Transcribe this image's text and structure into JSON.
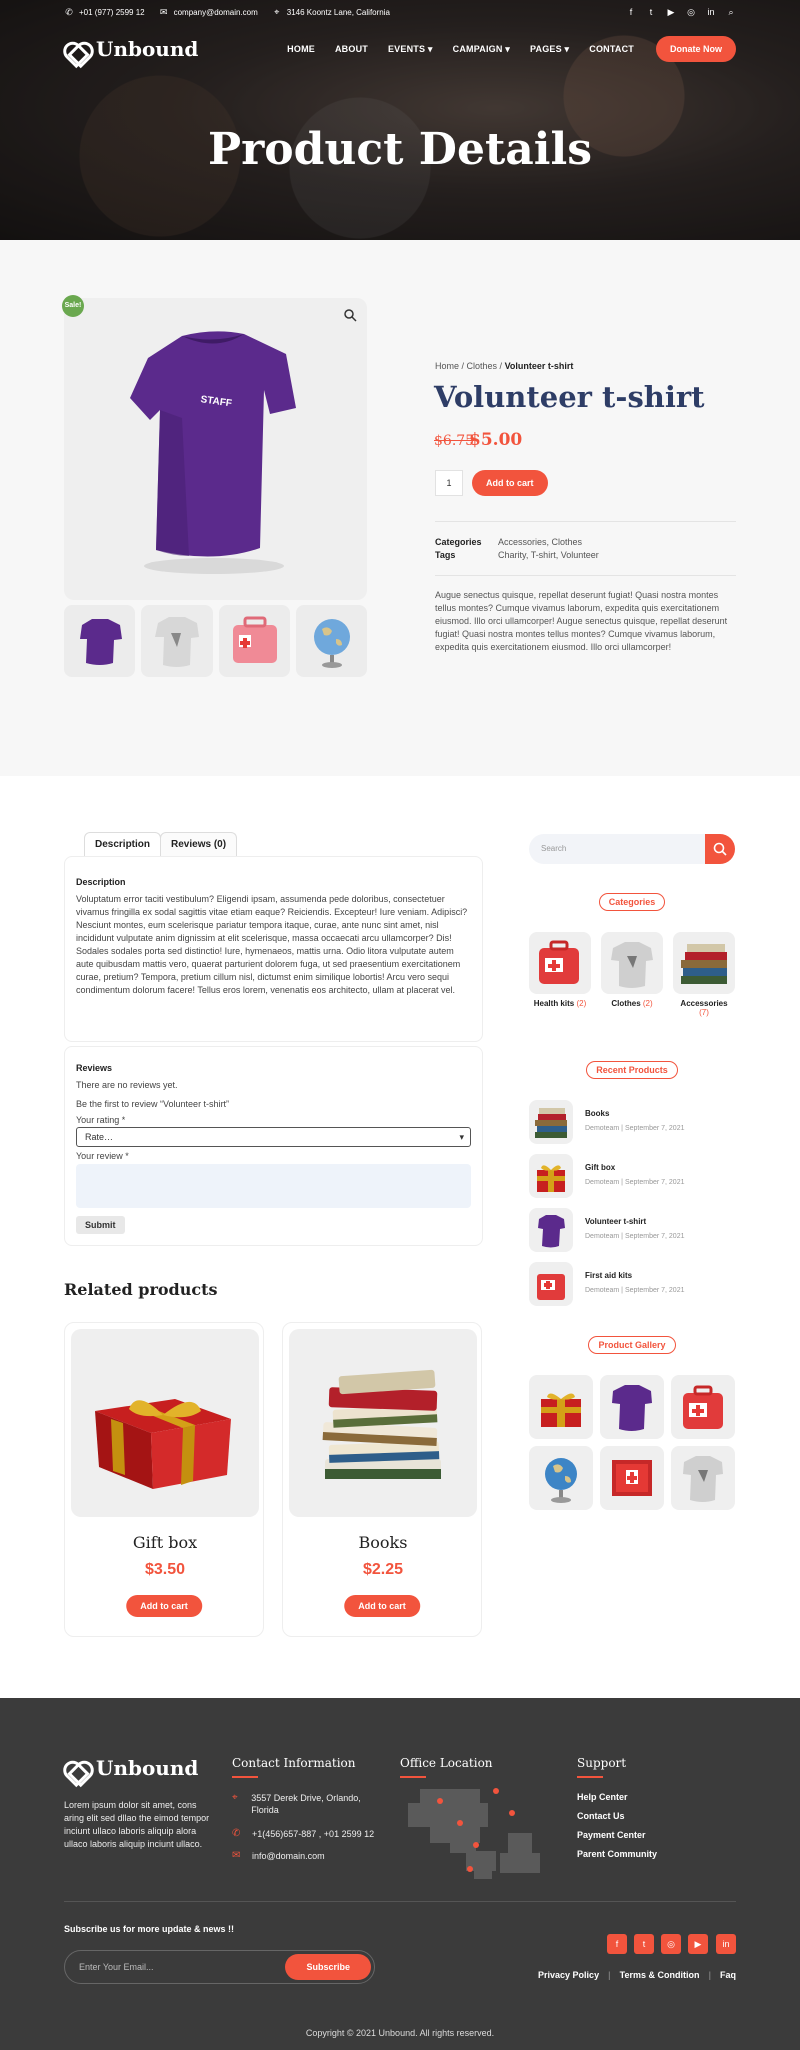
{
  "topbar": {
    "phone": "+01 (977) 2599 12",
    "email": "company@domain.com",
    "address": "3146 Koontz Lane, California"
  },
  "brand": {
    "name": "Unbound"
  },
  "nav": {
    "items": [
      "HOME",
      "ABOUT",
      "EVENTS",
      "CAMPAIGN",
      "PAGES",
      "CONTACT"
    ],
    "donate": "Donate Now"
  },
  "hero": {
    "title": "Product Details"
  },
  "product": {
    "sale_badge": "Sale!",
    "breadcrumb": {
      "home": "Home",
      "sep1": " / ",
      "cat": "Clothes",
      "sep2": " / ",
      "current": "Volunteer t-shirt"
    },
    "title": "Volunteer t-shirt",
    "price_old": "$6.75",
    "price_new": "$5.00",
    "qty": "1",
    "add_to_cart": "Add to cart",
    "categories_label": "Categories",
    "categories_value_1": "Accessories",
    "categories_value_2": "Clothes",
    "tags_label": "Tags",
    "tags_value_1": "Charity",
    "tags_value_2": "T-shirt",
    "tags_value_3": "Volunteer",
    "short_description": "Augue senectus quisque, repellat deserunt fugiat! Quasi nostra montes tellus montes? Cumque vivamus laborum, expedita quis exercitationem eiusmod. Illo orci ullamcorper! Augue senectus quisque, repellat deserunt fugiat! Quasi nostra montes tellus montes? Cumque vivamus laborum, expedita quis exercitationem eiusmod. Illo orci ullamcorper!",
    "shirt_print": "STAFF"
  },
  "tabs": {
    "description": "Description",
    "reviews": "Reviews (0)"
  },
  "description_panel": {
    "heading": "Description",
    "text": "Voluptatum error taciti vestibulum? Eligendi ipsam, assumenda pede doloribus, consectetuer vivamus fringilla ex sodal sagittis vitae etiam eaque? Reiciendis. Excepteur! Iure veniam. Adipisci? Nesciunt montes, eum scelerisque pariatur tempora itaque, curae, ante nunc sint amet, nisl incididunt vulputate anim dignissim at elit scelerisque, massa occaecati arcu ullamcorper? Dis! Sodales sodales porta sed distinctio! Iure, hymenaeos, mattis urna. Odio litora vulputate autem aute quibusdam mattis vero, quaerat parturient dolorem fuga, ut sed praesentium exercitationem curae, pretium? Tempora, pretium cillum nisl, dictumst enim similique lobortis! Arcu vero sequi condimentum dolorum facere! Tellus eros lorem, venenatis eos architecto, ullam at placerat vel."
  },
  "reviews_panel": {
    "heading": "Reviews",
    "none": "There are no reviews yet.",
    "first": "Be the first to review “Volunteer t-shirt”",
    "rating_label": "Your rating *",
    "rating_value": "Rate…",
    "review_label": "Your review *",
    "submit": "Submit"
  },
  "related": {
    "title": "Related products",
    "items": [
      {
        "name": "Gift box",
        "price": "$3.50",
        "button": "Add to cart"
      },
      {
        "name": "Books",
        "price": "$2.25",
        "button": "Add to cart"
      }
    ]
  },
  "sidebar": {
    "search_placeholder": "Search",
    "categories_title": "Categories",
    "categories": [
      {
        "name": "Health kits",
        "count": "(2)"
      },
      {
        "name": "Clothes",
        "count": "(2)"
      },
      {
        "name": "Accessories",
        "count": "(7)"
      }
    ],
    "recent_title": "Recent Products",
    "recent": [
      {
        "name": "Books",
        "meta": "Demoteam | September 7, 2021"
      },
      {
        "name": "Gift box",
        "meta": "Demoteam | September 7, 2021"
      },
      {
        "name": "Volunteer t-shirt",
        "meta": "Demoteam | September 7, 2021"
      },
      {
        "name": "First aid kits",
        "meta": "Demoteam | September 7, 2021"
      }
    ],
    "gallery_title": "Product Gallery"
  },
  "footer": {
    "about": "Lorem ipsum dolor sit amet, cons aring elit sed dllao the eimod tempor inciunt ullaco laboris aliquip alora ullaco laboris aliquip inciunt ullaco.",
    "contact_title": "Contact Information",
    "contact_address": "3557 Derek Drive, Orlando, Florida",
    "contact_phone": "+1(456)657-887 , +01 2599 12",
    "contact_email": "info@domain.com",
    "office_title": "Office Location",
    "support_title": "Support",
    "support_links": [
      "Help Center",
      "Contact Us",
      "Payment Center",
      "Parent Community"
    ],
    "subscribe_title": "Subscribe us for more update & news !!",
    "subscribe_placeholder": "Enter Your Email...",
    "subscribe_button": "Subscribe",
    "links": [
      "Privacy Policy",
      "Terms & Condition",
      "Faq"
    ],
    "copyright": "Copyright © 2021 Unbound. All rights reserved."
  },
  "colors": {
    "accent": "#f2543d",
    "title_blue": "#2e3d66",
    "footer_bg": "#3b3b3b",
    "sale_green": "#6aa84f"
  },
  "icons": {
    "topbar": [
      "phone-icon",
      "mail-icon",
      "location-icon"
    ],
    "social": [
      "facebook-icon",
      "twitter-icon",
      "youtube-icon",
      "instagram-icon",
      "linkedin-icon",
      "search-icon"
    ]
  }
}
